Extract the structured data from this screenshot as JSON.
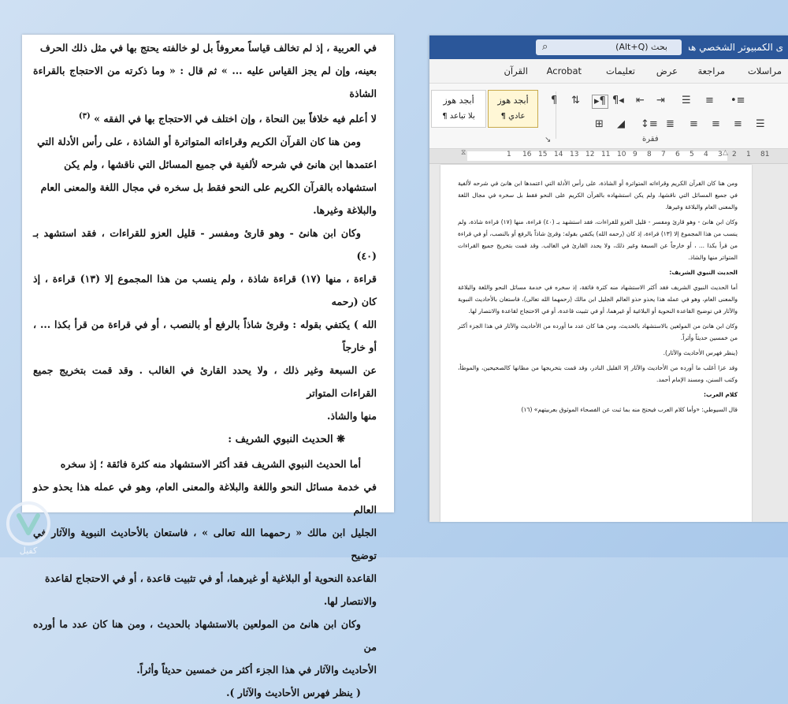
{
  "scan_page": {
    "lines": [
      "في العربية ، إذ لم تخالف قياساً معروفاً بل لو خالفته يحتج بها في مثل ذلك الحرف",
      "بعينه، وإن لم يجز القياس عليه ... » ثم قال : « وما ذكرته من الاحتجاج بالقراءة الشاذة",
      "لا أعلم فيه خلافاً بين النحاة ، وإن اختلف في الاحتجاج بها في الفقه »",
      "ومن هنا كان القرآن الكريم وقراءاته المتواترة أو الشاذة ، على رأس الأدلة التي",
      "اعتمدها ابن هانئ في شرحه لألفية في جميع المسائل التي ناقشها ، ولم يكن",
      "استشهاده بالقرآن الكريم على النحو فقط بل سخره في مجال اللغة والمعنى العام",
      "والبلاغة وغيرها.",
      "وكان ابن هانئ - وهو قارئ ومفسر - قليل العزو للقراءات ، فقد استشهد بـ (٤٠)",
      "قراءة ، منها (١٧) قراءة شاذة ، ولم ينسب من هذا المجموع إلا (١٣) قراءة ، إذ كان (رحمه",
      "الله ) يكتفي بقوله : وقرئ شاذاً بالرفع أو بالنصب ، أو في قراءة من قرأ بكذا ... ، أو خارجاً",
      "عن السبعة وغير ذلك ، ولا يحدد القارئ في الغالب . وقد قمت بتخريج جميع القراءات المتواتر",
      "منها والشاذ.",
      "❋ الحديث النبوي الشريف :",
      "أما الحديث النبوي الشريف فقد أكثر الاستشهاد منه كثرة فائقة ؛ إذ سخره",
      "في خدمة مسائل النحو واللغة والبلاغة والمعنى العام، وهو في عمله هذا يحذو حذو العالم",
      "الجليل ابن مالك « رحمهما الله تعالى » ، فاستعان بالأحاديث النبوية والآثار في توضيح",
      "القاعدة النحوية أو البلاغية أو غيرهما، أو في تثبيت قاعدة ، أو في الاحتجاج لقاعدة",
      "والانتصار لها.",
      "وكان ابن هانئ من المولعين بالاستشهاد بالحديث ، ومن هنا كان عدد ما أورده من",
      "الأحاديث والآثار في هذا الجزء أكثر من خمسين حديثاً وأثراً.",
      "( ينظر فهرس الأحاديث والآثار )."
    ],
    "footnote_mark": "(٣)"
  },
  "word": {
    "title": "ى الكمبيوتر الشخصي هذا",
    "search_text": "بحث (Alt+Q)",
    "tabs": [
      "مراسلات",
      "مراجعة",
      "عرض",
      "تعليمات",
      "Acrobat",
      "القرآن"
    ],
    "styles": [
      {
        "sample": "أبجد هوز",
        "name": "¶ عادي"
      },
      {
        "sample": "أبجد هوز",
        "name": "¶ بلا تباعد"
      }
    ],
    "paragraph_group_label": "فقرة",
    "ruler_numbers": [
      "81",
      "1",
      "2",
      "3",
      "4",
      "5",
      "6",
      "7",
      "8",
      "9",
      "10",
      "11",
      "12",
      "13",
      "14",
      "15",
      "16",
      "1"
    ],
    "doc_paragraphs": [
      "ومن هنا كان القرآن الكريم وقراءاته المتواترة أو الشاذة، على رأس الأدلة التي اعتمدها ابن هانئ في شرحه لألفية في جميع المسائل التي ناقشها، ولم يكن استشهاده بالقرآن الكريم على النحو فقط بل سخره في مجال اللغة والمعنى العام والبلاغة وغيرها.",
      "وكان ابن هانئ - وهو قارئ ومفسر - قليل العزو للقراءات، فقد استشهد بـ (٤٠) قراءة، منها (١٧) قراءة شاذة، ولم ينسب من هذا المجموع إلا (١٣) قراءة، إذ كان (رحمه الله) يكتفي بقوله: وقرئ شاذاً بالرفع أو بالنصب، أو في قراءة من قرأ بكذا ... ، أو خارجاً عن السبعة وغير ذلك، ولا يحدد القارئ في الغالب. وقد قمت بتخريج جميع القراءات المتواتر منها والشاذ.",
      "الحديث النبوي الشريف:",
      "أما الحديث النبوي الشريف فقد أكثر الاستشهاد منه كثرة فائقة، إذ سخره في خدمة مسائل النحو واللغة والبلاغة والمعنى العام، وهو في عمله هذا يحذو حذو العالم الجليل ابن مالك (رحمهما الله تعالى)، فاستعان بالأحاديث النبوية والآثار في توضيح القاعدة النحوية أو البلاغية أو غيرهما، أو في تثبيت قاعدة، أو في الاحتجاج لقاعدة والانتصار لها.",
      "وكان ابن هانئ من المولعين بالاستشهاد بالحديث، ومن هنا كان عدد ما أورده من الأحاديث والآثار في هذا الجزء أكثر من خمسين حديثاً وأثراً.",
      "(ينظر فهرس الأحاديث والآثار).",
      "وقد عزا أغلب ما أورده من الأحاديث والآثار إلا القليل النادر، وقد قمت بتخريجها من مظانها كالصحيحين، والموطأ، وكتب السنن، ومسند الإمام أحمد.",
      "كلام العرب:",
      "قال السيوطي: «وأما كلام العرب فيحتج منه بما ثبت عن الفصحاء الموثوق بعربيتهم» (١٦)"
    ]
  },
  "logo": {
    "text": "كفيل"
  }
}
